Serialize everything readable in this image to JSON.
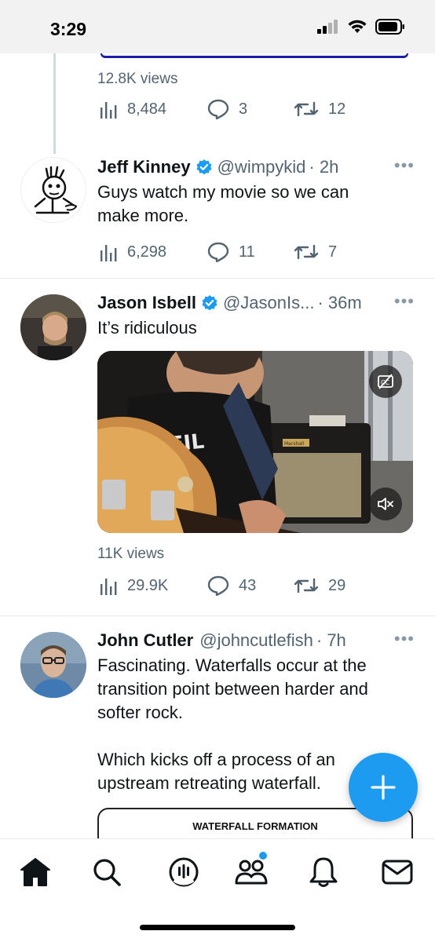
{
  "status": {
    "time": "3:29"
  },
  "tweets": [
    {
      "views_label": "12.8K views",
      "stats": {
        "views": "8,484",
        "replies": "3",
        "retweets": "12"
      }
    },
    {
      "name": "Jeff Kinney",
      "handle": "@wimpykid",
      "time": "· 2h",
      "text_lines": [
        "Guys watch my movie so we can",
        "make more."
      ],
      "stats": {
        "views": "6,298",
        "replies": "11",
        "retweets": "7"
      }
    },
    {
      "name": "Jason Isbell",
      "handle": "@JasonIs...",
      "time": "· 36m",
      "text_lines": [
        "It’s ridiculous"
      ],
      "media": {
        "amp_label": "Marshall",
        "shirt_text": "CEIL"
      },
      "views_label": "11K views",
      "stats": {
        "views": "29.9K",
        "replies": "43",
        "retweets": "29"
      }
    },
    {
      "name": "John Cutler",
      "handle": "@johncutlefish",
      "time": "· 7h",
      "text_lines": [
        "Fascinating. Waterfalls occur at the",
        "transition point between harder and",
        "softer rock.",
        "",
        "Which kicks off a process of an",
        "upstream retreating waterfall."
      ],
      "card_title": "WATERFALL FORMATION"
    }
  ],
  "more_label": "•••",
  "colors": {
    "accent": "#1d9bf0",
    "text": "#0f1419",
    "secondary": "#536471"
  },
  "tabs": [
    "home-icon",
    "search-icon",
    "spaces-icon",
    "communities-icon",
    "notifications-icon",
    "messages-icon"
  ]
}
